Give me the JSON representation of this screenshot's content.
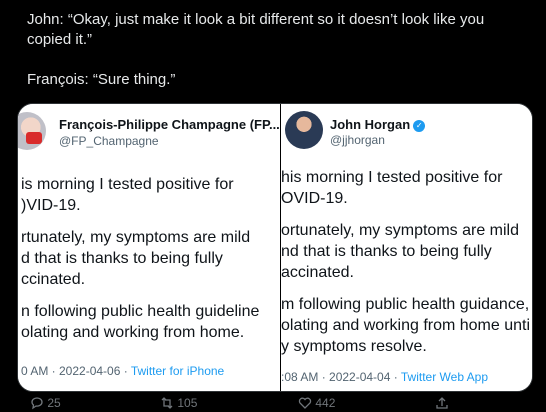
{
  "tweet": {
    "line1": "John: “Okay, just make it look a bit different so it doesn’t look like you",
    "line2": "copied it.”",
    "line3": "François: “Sure thing.”"
  },
  "left_card": {
    "name": "François-Philippe Champagne (FP...",
    "handle": "@FP_Champagne",
    "body": [
      "is morning I tested positive for",
      ")VID-19.",
      "rtunately, my symptoms are mild",
      "d that is thanks to being fully",
      "ccinated.",
      "n following public health guideline",
      "olating and working from home."
    ],
    "time": "0 AM · 2022-04-06 · ",
    "app": "Twitter for iPhone"
  },
  "right_card": {
    "name": "John Horgan",
    "handle": "@jjhorgan",
    "body": [
      "his morning I tested positive for",
      "OVID-19.",
      "ortunately, my symptoms are mild",
      "nd that is thanks to being fully",
      "accinated.",
      "m following public health guidance,",
      "olating and working from home unti",
      "y symptoms resolve."
    ],
    "time": ":08 AM · 2022-04-04 · ",
    "app": "Twitter Web App"
  },
  "actions": {
    "reply_count": "25",
    "retweet_count": "105",
    "like_count": "442"
  },
  "colors": {
    "background": "#000000",
    "text": "#e7e9ea",
    "accent": "#1d9bf0",
    "muted": "#536471"
  },
  "icons": [
    "verified-badge-icon",
    "reply-icon",
    "retweet-icon",
    "like-icon",
    "share-icon"
  ]
}
